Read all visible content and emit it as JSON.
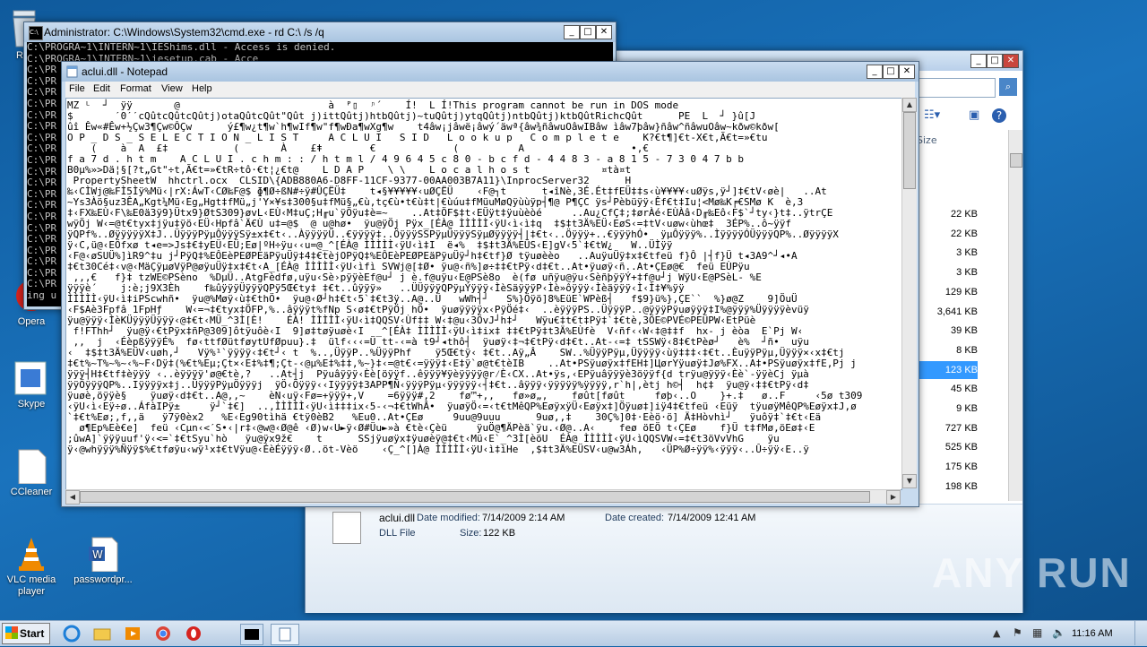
{
  "desktop_icons": [
    {
      "label": "Re"
    },
    {
      "label": "Opera"
    },
    {
      "label": "Skype"
    },
    {
      "label": "CCleaner"
    },
    {
      "label": "VLC media player"
    },
    {
      "label": "passwordpr..."
    }
  ],
  "cmd": {
    "title": "Administrator: C:\\Windows\\System32\\cmd.exe - rd  C:\\ /s /q",
    "lines": [
      "C:\\PROGRA~1\\INTERN~1\\IEShims.dll - Access is denied.",
      "C:\\PROGRA~1\\INTERN~1\\iesetup.cab - Acce",
      "C:\\PR",
      "C:\\PR",
      "C:\\PR",
      "C:\\PR",
      "C:\\PR",
      "C:\\PR",
      "C:\\PR",
      "C:\\PR",
      "C:\\PR",
      "C:\\PR",
      "C:\\PR",
      "C:\\PR",
      "C:\\PR",
      "C:\\PR",
      "C:\\PR",
      "C:\\PR",
      "C:\\PR",
      "C:\\PR",
      "C:\\PR",
      "C:\\PR",
      "ing u"
    ]
  },
  "notepad": {
    "title": "aclui.dll - Notepad",
    "menu": [
      "File",
      "Edit",
      "Format",
      "View",
      "Help"
    ],
    "lines": [
      "MZ ᴸ  ┘  ÿÿ       @                         à  ᴾ▯  ᶮ´    Í!  L Í!This program cannot be run in DOS mode",
      "$       ˊ0ˊˊcQûtcQûtcQûtj)otaQûtcQût\"Qût j)ittQûtj)htbQûtj)~tuQûtj)ytqQûtj)ntbQûtj)ktbQûtRichcQût      PE  L  ┘ }û[J",
      "ûî Êw«#Êw+½Çw3¶Çw©ÔÇw      ý£¶w¿t¶w`h¶wIf¶w\"f¶wÐa¶wXg¶w    t4âw¡jâwë¡âwý´äwª{âw¾ñâwuOâwIBâw ìâw7þâw}ñâw^ñâwuOâw~kðw©kðw[",
      "O P _ D S _ S E L E C T I O N _ L I S T     A C L U I   S I D   L o o k u p   C o m p l e t e    K?€t¶]€t-X€t,Ã€t=»€tu",
      "    (    à  A  £‡           (       À    £ǂ        €             (          A                  •,€",
      "f a 7 d . h t m    A C L U I . c h m : : / h t m l / 4 9 6 4 5 c 8 0 - b c f d - 4 4 8 3 - a 8 1 5 - 7 3 0 4 7 b b",
      "B0µ%»>Dä¦§[?t„Gt\"÷t,Ã€t=»€tR÷tô·€t¦¿€t@    L D A P    \\ \\    L o c a l h o s t            ¤tà¤t",
      " PropertySheetW  hhctrl.ocx  CLSID\\{ADB880A6-D8FF-11CF-9377-00AA003B7A11}\\InprocServer32      H",
      "‰‹CÌWj@‰FÌ5Ìÿ%Mü‹|rX:ÁwT‹CØ‰F@$ ɸ¶Ø÷ßN#÷ÿ#ÛÇËÜ‡    t◂§¥¥¥¥¥‹uØÇËÜ    ‹F@┐t      t◂îNè,3É.Ét‡fEÜ‡‡s‹ù¥¥¥¥‹uØÿs,ÿ┘]‡€tV‹øè|   ..At",
      "~Ys3Àö§uz3ÊA„Kgt¼Mü‹Eg„Hgt‡fMü„j'Y×¥s‡300§u‡fMü§„€ù,tç€ù•t€ù‡t|€ùúu‡fMüuMøQÿùùÿp┤¶@ P¶ÇC ÿs┘Pèbüÿÿ‹Êf€t‡Iu¦<Mø‰K╒€SMø K  è,3",
      "‡‹FX‰EÙ‹F\\‰E0ä3ÿ9}Ütx9}ØtS309}øvL‹EÙ‹M‡uÇ;H╓u`ÿÖÿu‡è=~    ..At‡ÖF$‡t‹EÜÿt‡ÿuùèòé     ..Au¿CfÇ‡;‡ørÀé‹EÙÀâ‹D╓‰Eô‹F$`┘ty‹}t‡..ÿtrÇE",
      "wÿÖj W‹=@t€tyx‡jÿu‡ÿö‹EÜ‹Hpfâ`Ä€Ù u‡=@$  @ u@hø•  ÿu@ÿÖj Pÿx_[ÉÀ@ ÌÌÌÌÌ‹ÿU‹ì‹ì‡q  ‡$‡t3Ä%EÜ‹EøS‹=‡tV‹uøw‹ùhœ‡  3ÉP%..ô~ÿÿf",
      "ÿQPf%..ØÿÿÿÿÿX‡J..ÜÿÿÿPÿµÔÿÿÿSÿ±x‡€t‹..ÀÿÿÿÿÜ..€ÿÿÿÿ‡..ÖÿÿÿSSPÿµÜÿÿÿSÿµØÿÿÿÿ┤|‡€t‹..Öÿÿÿ+..€ÿÿÿhÓ•  ÿµÔÿÿÿ%..ÌÿÿÿÿÓÜÿÿÿQP%..ØÿÿÿÿX",
      "ÿ‹C‚ü@‹EÖfxø t◂e=>Js‡€‡yEÜ‹EÜ;Eø|ºH÷ÿu‹‹u=@_^[ÉÀ@ ÌÌÌÌÌ‹ÿU‹ì‡I  ë◂%  ‡$‡t3Ä%EÜS‹E]gV‹5`‡€tW¿   W..ÜÌÿÿ",
      "‹F@‹øSUÜ%]ìR9^‡u j┘PÿQ‡%EÔEèPEØPEäPÿuÜÿ‡4‡€tèjOPÿQ‡%EÔEèPEØPEäPÿuÜÿ┘h‡€tf}Ø tÿuøèèo   ..AuÿuÜÿ‡x‡€tfeü f}Ô |┤f}Ü t◂3A9^┘◂•A",
      "‡€t30Cé‡‹v@‹MäÇÿµøVÿP@øÿuÜÿ‡x‡€t‹A_[ÉÀ@ ÌÌÌÌÌ‹ÿU‹ìfì SVWj@[‡Ø• ÿu@‹ñ%]ø÷‡‡€tPÿ‹d‡€t..At•ÿuøÿ‹ñ..At•ÇEø@€  feü EÙPÿu",
      " ‚,‚€   f}‡ tzWE©PSèno  %DµÜ..AtgFèdfø‚uÿu‹Sè›pÿÿèEf@u┘ j è.f@uÿu‹E@PSè8o  è(fø uñÿu@ÿu‹SèñþÿÿÝ+‡f@u┘j WÿU‹E@PSèL- %E",
      "ÿÿÿè´    j:è;j9X3Èh    f‰ûÿÿÿÜÿÿÿQPÿ5Œ€ty‡ ‡€t..ûÿÿÿ»   ..ÜÜÿÿÿQPÿµÝÿÿÿ‹ÌèSäÿÿÿP‹Ìè»ôÿÿÿ‹Ìèäÿÿÿ‹Ì‹Ì‡¥%ÿÿ",
      "ÌÌÌÌÌ‹ÿU‹ì‡iPScwhñ•  ÿu@%Møÿ‹ù‡€thÖ•  ÿu@‹Ø┘h‡€t‹5`‡€t3ÿ..A@..Ü   wWh┤┘   S%}Öÿö]8%EüE`WPèß┤   f$9}ü%}‚ÇE``  %}ø@Z    9]ÖuÜ",
      "‹F$Aè3Fpfâ 1FpHƒ    W‹=¬‡€tyx‡ÖFP,%..âÿÿÿt%fNp S‹ø‡€tPÿÖj hÖ•  ÿuøÿÿÿÿx‹PÿÖé‡‹  ..èÿÿÿPS..ÜÿÿÿP..@ÿÿÿPÿuøÿÿÿ‡I%@ÿÿÿ%Üÿÿÿÿèvüÿ",
      "ÿu@ÿÿÿ‹ÌèKÜÿÿÿÜÿÿÿ‹@‡€t‹MÜ_^3Ì[È!    ÉÀ! ÌÌÌÌÌ‹ÿU‹ì‡QQSV‹Ùf‡‡ W‹‡@u‹3ÖvJ┘h‡┘   Wÿu€‡t€t‡Pÿ‡`‡€tè,3ÖE©PVÉ©PEÜPW‹EtPüè",
      " f!FThh┘  ÿu@ÿ‹€tPÿx‡ñP@309]ôtÿuôè‹I  9]ø‡tøÿuøè‹I  _^[ÉÀ‡ ÌÌÌÌÌ‹ÿU‹ì‡ix‡ ‡‡€tPÿ‡t3Ä%EÙfè  V‹ñf‹‹W‹‡@‡‡f  hx- j èòa  E`Pj W‹",
      " ,‚  j  ‹ÉèpßÿÿÿÉ%  fø‹ttfØütføytUfØpuu}.‡  ülf‹‹‹=Ü tt-‹=à t9┘◂thô┤  ÿuøÿ‹‡¬‡€tPÿ‹d‡€t..At-‹=‡ tSSWÿ‹8‡€tPèø┘   è%  ┘ñ•  uÿu",
      "‹  ‡$‡t3Ä%EÜV‹uøh‚┘   Vÿ%¹`ÿÿÿÿ‹‡€t┘‹ t  %..,ÜÿÿP..%ÜÿÿPhf    ÿ5Œ€tÿ‹ ‡€t..Aÿ„Â    SW..%ÜÿÿPÿµ,Üÿÿÿÿ‹ùÿ‡‡‡‹‡€t..ÈuÿÿPÿµ,Üÿÿÿ×‹x‡€tj",
      "‡€t%~T%~%~‹%~F‹Dÿ‡(%€t%Eµ;Çt×‹E‡%‡¶;Çt-‹@µ%E‡%‡‡,%~}‡‹=@t€‹=ÿÿÿ‡‹E‡ÿ`ø@t€tèIB    ..At•PSÿuøÿx‡fEH‡]ЦørYÿuøÿ‡Jø%FX..A‡•PSÿuøÿx‡fE,Pj j",
      "ÿÿÿ┤H‡€tf‡èÿÿÿ ‹..èÿÿÿÿ'ø@€tè,?   ..At┤j  Pÿuâÿÿÿ‹Èè[öÿÿf..êÿÿÿ¥ÿèÿÿÿÿ@r⁄È‹CX..At•ÿs‚‹EPÿuâÿÿÿè3öÿÿf{d trÿu@ÿÿÿ‹Èè`-ÿÿèCj ÿµà",
      "ÿÿÖÿÿÿQP%..Iÿÿÿÿx‡j..ÜÿÿÿPÿµÖÿÿÿj  ÿÖ‹Öÿÿÿ‹‹Iÿÿÿÿ‡3APP¶Ñ‹ÿÿÿPÿµ‹ÿÿÿÿÿ‹┤‡€t..âÿÿÿ‹ÿÿÿÿÿ%ÿÿÿÿ‚r`h|‚ètj h©┤  h¢‡  ÿu@ÿ‹‡‡€tPÿ‹d‡",
      "ÿuøè‚öÿÿè§    ÿuøÿ‹d‡€t..A@,‚~    èN‹uÿ‹Fø=+ÿÿÿ+,V    =6ÿÿÿ#,2    fø™+,‚   fø»ø„‚    føût[føût     føþ‹..O    }+.‡   ø..F     ‹5ø t309",
      "‹ÿU‹ì‹Eÿ÷ø..ÁfàIPÿ±     ÿ┘`‡€]  ..,ÌÌÌÌÌ‹ÿU‹ì‡‡‡ix‹5-‹¬‡€tWhÂ•  ÿuøÿÖ‹=‹t€tMêQP%EøÿxÿÜ‹Eøÿx‡]Öÿuø‡]iÿ4‡€tfeü ‹Eüÿ  tÿuøÿMêQP%Eøÿx‡J,ø",
      "`‡€t%Eø;‚f‚,ä   ÿ7ÿ0èx2   %E‹Eg90tìhä €tÿ0èB2   %Eu0..At•ÇEø     9uu@9uuu      9uø‚,‡    30Ç%]0‡·Eèö·ö] Ä‡Hòvhì┘   ÿuôÿ‡`‡€t‹Eä",
      "  ø¶Ep%Eè€e]  feü ‹Cµn‹<ˊS•‹|r‡‹@w@‹Ø@ê ‹Ø)w‹U►ÿ‹Ø#Üu►»à €tè‹Çèü     ÿuÖ@¶ÄPèä`ÿu.‹Ø@..A‹    feø öEÖ t‹ÇEø    f}Ü t‡fMø,öEø‡‹E",
      ";ûwA]`ÿÿÿuuf'ÿ‹<=`‡€tSyu`hò   ÿu@ÿx9ž€    t      SSjÿuøÿx‡ÿuøèÿ@‡€t‹Mü‹E`_^3Ì[èöU  ÉÀ@ ÌÌÌÌÌ‹ÿU‹ìQQSVW‹=‡€t3öVvVhG    ÿu",
      "ÿ‹@whÿÿÿ%Ñÿÿ$%€tføÿu‹wÿ¹x‡€tVÿu@‹ÉèÉÿÿÿ‹Ø..öt-Vèö    ‹Ç_^[]À@ ÌÌÌÌÌ‹ÿU‹ì‡ìHe  ‚$‡t3Ä%EÜSV‹u@w3Áh,   ‹ÜP%Ø÷ÿÿ%‹ÿÿÿ‹..Û÷ÿÿ‹E..ÿ"
    ]
  },
  "explorer": {
    "title_partial": "Fo",
    "search_placeholder": "",
    "column_header": "Size",
    "sizes": [
      "22 KB",
      "22 KB",
      "3 KB",
      "3 KB",
      "129 KB",
      "3,641 KB",
      "39 KB",
      "8 KB",
      "123 KB",
      "45 KB",
      "9 KB",
      "727 KB",
      "525 KB",
      "175 KB",
      "198 KB"
    ],
    "selected_index": 8,
    "details": {
      "filename": "aclui.dll",
      "modified_label": "Date modified:",
      "modified_value": "7/14/2009 2:14 AM",
      "created_label": "Date created:",
      "created_value": "7/14/2009 12:41 AM",
      "type": "DLL File",
      "size_label": "Size:",
      "size_value": "122 KB"
    }
  },
  "taskbar": {
    "start_label": "Start",
    "time": "11:16 AM"
  },
  "watermark": "ANY RUN",
  "colors": {
    "selection": "#3399ff",
    "desktop": "#1565a8"
  }
}
